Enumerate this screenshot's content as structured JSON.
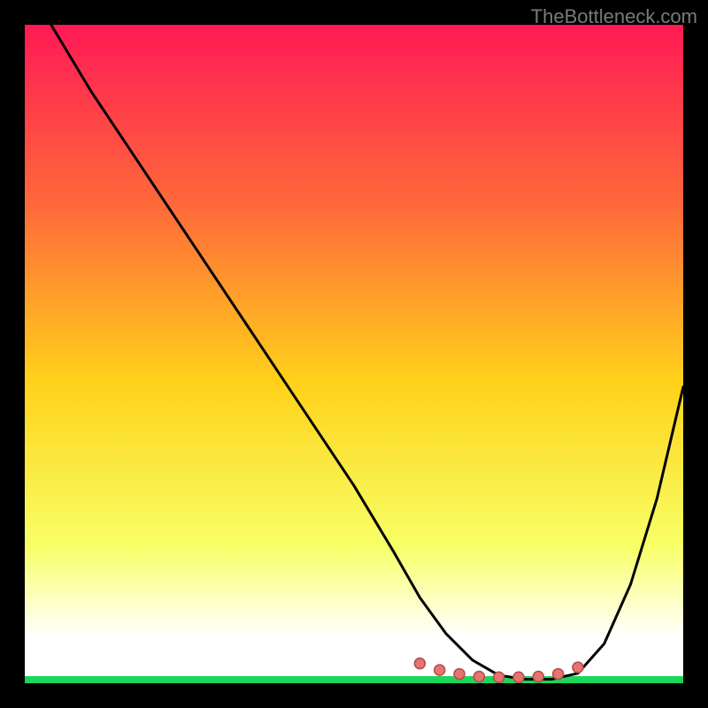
{
  "watermark": "TheBottleneck.com",
  "colors": {
    "bg": "#000000",
    "curve": "#000000",
    "dotFill": "#e6736e",
    "dotStroke": "#b34b4b",
    "gradientTop": "#ff1a55",
    "gradientMidTop": "#ff6a3a",
    "gradientMid": "#ffd21a",
    "gradientMidBot": "#f7ff66",
    "gradientBot": "#ffffff",
    "footer": "#1bd65a"
  },
  "chart_data": {
    "type": "line",
    "title": "",
    "xlabel": "",
    "ylabel": "",
    "xlim": [
      0,
      100
    ],
    "ylim": [
      0,
      100
    ],
    "grid": false,
    "legend": false,
    "series": [
      {
        "name": "bottleneck-curve",
        "x": [
          4,
          10,
          18,
          26,
          34,
          42,
          50,
          56,
          60,
          64,
          68,
          72,
          76,
          80,
          84,
          88,
          92,
          96,
          100
        ],
        "values": [
          100,
          90,
          78,
          66,
          54,
          42,
          30,
          20,
          13,
          7.5,
          3.5,
          1.2,
          0.6,
          0.6,
          1.5,
          6,
          15,
          28,
          45
        ]
      }
    ],
    "dots": {
      "name": "optimal-range-markers",
      "x": [
        60,
        63,
        66,
        69,
        72,
        75,
        78,
        81,
        84
      ],
      "values": [
        3.0,
        2.0,
        1.4,
        1.0,
        0.9,
        0.9,
        1.0,
        1.4,
        2.4
      ]
    }
  }
}
